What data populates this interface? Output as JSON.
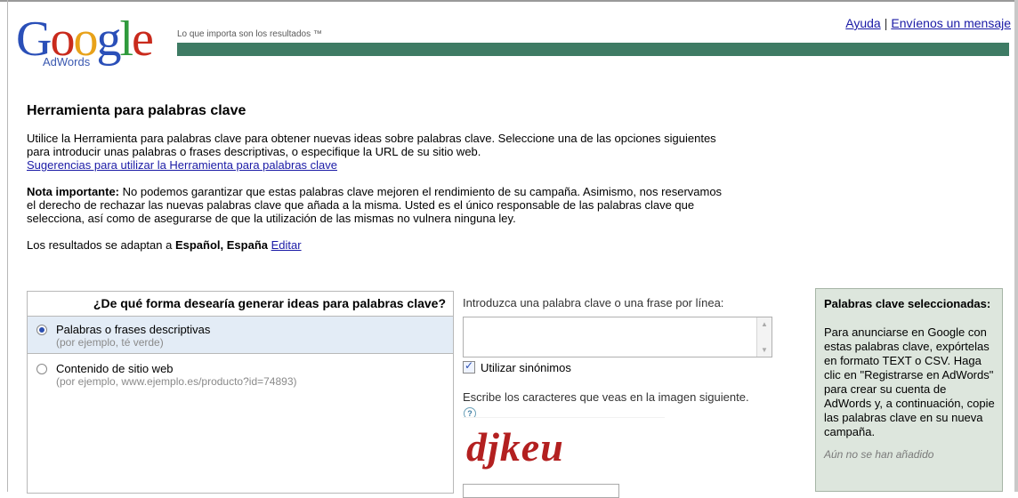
{
  "header": {
    "logo_word": "Google",
    "logo_sub": "AdWords",
    "tagline": "Lo que importa son los resultados ™",
    "links": {
      "help": "Ayuda",
      "separator": "|",
      "message": "Envíenos un mensaje"
    },
    "colors": {
      "bar": "#3e7b64"
    }
  },
  "content": {
    "title": "Herramienta para palabras clave",
    "intro": "Utilice la Herramienta para palabras clave para obtener nuevas ideas sobre palabras clave. Seleccione una de las opciones siguientes para introducir unas palabras o frases descriptivas, o especifique la URL de su sitio web.",
    "intro_link": "Sugerencias para utilizar la Herramienta para palabras clave",
    "note_label": "Nota importante:",
    "note_text": " No podemos garantizar que estas palabras clave mejoren el rendimiento de su campaña. Asimismo, nos reservamos el derecho de rechazar las nuevas palabras clave que añada a la misma. Usted es el único responsable de las palabras clave que selecciona, así como de asegurarse de que la utilización de las mismas no vulnera ninguna ley.",
    "results_prefix": "Los resultados se adaptan a ",
    "results_lang": "Español, España",
    "results_edit": "Editar"
  },
  "left_panel": {
    "question": "¿De qué forma desearía generar ideas para palabras clave?",
    "options": [
      {
        "label": "Palabras o frases descriptivas",
        "example": "(por ejemplo, té verde)",
        "selected": true
      },
      {
        "label": "Contenido de sitio web",
        "example": "(por ejemplo, www.ejemplo.es/producto?id=74893)",
        "selected": false
      }
    ]
  },
  "mid_panel": {
    "keywords_label": "Introduzca una palabra clave o una frase por línea:",
    "keywords_value": "",
    "synonyms_label": "Utilizar sinónimos",
    "synonyms_checked": true,
    "captcha_label": "Escribe los caracteres que veas en la imagen siguiente.",
    "help_icon": "?",
    "captcha_text": "djkeu",
    "captcha_input_value": ""
  },
  "right_panel": {
    "title": "Palabras clave seleccionadas:",
    "body": "Para anunciarse en Google con estas palabras clave, expórtelas en formato TEXT o CSV. Haga clic en \"Registrarse en AdWords\" para crear su cuenta de AdWords y, a continuación, copie las palabras clave en su nueva campaña.",
    "empty_state": "Aún no se han añadido"
  }
}
